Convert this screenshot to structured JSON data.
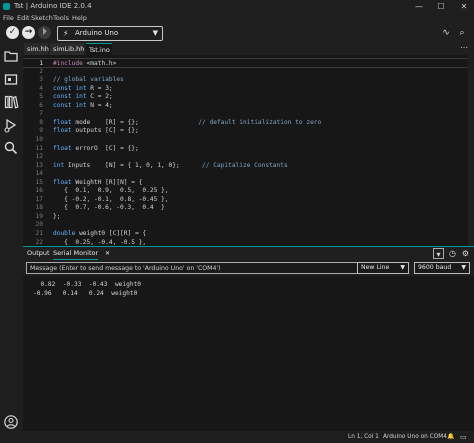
{
  "window": {
    "title": "Tst | Arduino IDE 2.0.4",
    "controls": {
      "minimize": "—",
      "maximize": "☐",
      "close": "✕"
    }
  },
  "menu": [
    "File",
    "Edit",
    "Sketch",
    "Tools",
    "Help"
  ],
  "toolbar": {
    "verify_glyph": "✓",
    "upload_glyph": "→",
    "debug_glyph": "⏵",
    "board_name": "Arduino Uno",
    "usb_glyph": "⚡",
    "chevron": "▼",
    "plotter_glyph": "∿",
    "monitor_glyph": "⌕"
  },
  "sidebar_icons": [
    "folder-icon",
    "boards-manager-icon",
    "library-manager-icon",
    "debug-icon",
    "search-icon",
    "account-icon"
  ],
  "tabs": [
    {
      "label": "sim.hh"
    },
    {
      "label": "simLib.hh"
    },
    {
      "label": "Tst.ino",
      "active": true
    }
  ],
  "tabs_more": "⋯",
  "editor": {
    "current_line": 1,
    "lines": [
      {
        "n": "1",
        "segs": [
          [
            "inc",
            "#include"
          ],
          [
            "lib",
            " <math.h>"
          ]
        ]
      },
      {
        "n": "2",
        "segs": []
      },
      {
        "n": "3",
        "segs": [
          [
            "cm",
            "// global variables"
          ]
        ]
      },
      {
        "n": "4",
        "segs": [
          [
            "kw",
            "const"
          ],
          [
            "",
            " "
          ],
          [
            "kw",
            "int"
          ],
          [
            "",
            " R = 3;"
          ]
        ]
      },
      {
        "n": "5",
        "segs": [
          [
            "kw",
            "const"
          ],
          [
            "",
            " "
          ],
          [
            "kw",
            "int"
          ],
          [
            "",
            " C = 2;"
          ]
        ]
      },
      {
        "n": "6",
        "segs": [
          [
            "kw",
            "const"
          ],
          [
            "",
            " "
          ],
          [
            "kw",
            "int"
          ],
          [
            "",
            " N = 4;"
          ]
        ]
      },
      {
        "n": "7",
        "segs": []
      },
      {
        "n": "8",
        "segs": [
          [
            "kw",
            "float"
          ],
          [
            "",
            " mode    [R] = {};                "
          ],
          [
            "cm",
            "// default initialization to zero"
          ]
        ]
      },
      {
        "n": "9",
        "segs": [
          [
            "kw",
            "float"
          ],
          [
            "",
            " outputs [C] = {};"
          ]
        ]
      },
      {
        "n": "10",
        "segs": []
      },
      {
        "n": "11",
        "segs": [
          [
            "kw",
            "float"
          ],
          [
            "",
            " errorO  [C] = {};"
          ]
        ]
      },
      {
        "n": "12",
        "segs": []
      },
      {
        "n": "13",
        "segs": [
          [
            "kw",
            "int"
          ],
          [
            "",
            " Inputs    [N] = { 1, 0, 1, 0};      "
          ],
          [
            "cm",
            "// Capitalize Constants"
          ]
        ]
      },
      {
        "n": "14",
        "segs": []
      },
      {
        "n": "15",
        "segs": [
          [
            "kw",
            "float"
          ],
          [
            "",
            " WeightH [R][N] = {"
          ]
        ]
      },
      {
        "n": "16",
        "segs": [
          [
            "",
            "   {  0.1,  0.9,  0.5,  0.25 },"
          ]
        ]
      },
      {
        "n": "17",
        "segs": [
          [
            "",
            "   { -0.2, -0.1,  0.8, -0.45 },"
          ]
        ]
      },
      {
        "n": "18",
        "segs": [
          [
            "",
            "   {  0.7, -0.6, -0.3,  0.4  }"
          ]
        ]
      },
      {
        "n": "19",
        "segs": [
          [
            "",
            "};"
          ]
        ]
      },
      {
        "n": "20",
        "segs": []
      },
      {
        "n": "21",
        "segs": [
          [
            "kw",
            "double"
          ],
          [
            "",
            " weight0 [C][R] = {"
          ]
        ]
      },
      {
        "n": "22",
        "segs": [
          [
            "",
            "   {  0.25, -0.4, -0.5 },"
          ]
        ]
      }
    ]
  },
  "output_panel": {
    "tabs": [
      {
        "label": "Output"
      },
      {
        "label": "Serial Monitor",
        "active": true,
        "close": "✕"
      }
    ],
    "icons": {
      "collapse": "▾",
      "autoscroll": "◷",
      "clear": "⚙"
    },
    "message_placeholder": "Message (Enter to send message to 'Arduino Uno' on 'COM4')",
    "line_ending": "New Line",
    "baud": "9600 baud",
    "select_chevron": "▼",
    "lines": [
      "  0.82  -0.33  -0.43  weight0",
      "-0.96   0.14   0.24  weight0"
    ]
  },
  "status": {
    "position": "Ln 1, Col 1",
    "board": "Arduino Uno on COM4",
    "notifications": "🔔",
    "sidebar_toggle": "▭"
  },
  "colors": {
    "accent": "#00979d",
    "keyword": "#5db4ff",
    "comment": "#7fa8c8",
    "include": "#c586c0"
  }
}
